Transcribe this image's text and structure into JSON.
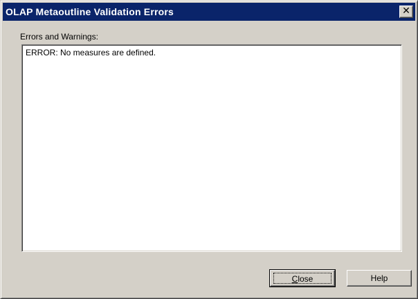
{
  "window": {
    "title": "OLAP Metaoutline Validation Errors",
    "close_glyph": "✕"
  },
  "errors_panel": {
    "label": "Errors and Warnings:",
    "lines": [
      "ERROR: No measures are defined."
    ]
  },
  "buttons": {
    "close_label": "Close",
    "close_mnemonic": "C",
    "help_label": "Help"
  },
  "colors": {
    "titlebar_bg": "#0a246a",
    "titlebar_text": "#ffffff",
    "dialog_bg": "#d4d0c8",
    "list_bg": "#ffffff"
  }
}
